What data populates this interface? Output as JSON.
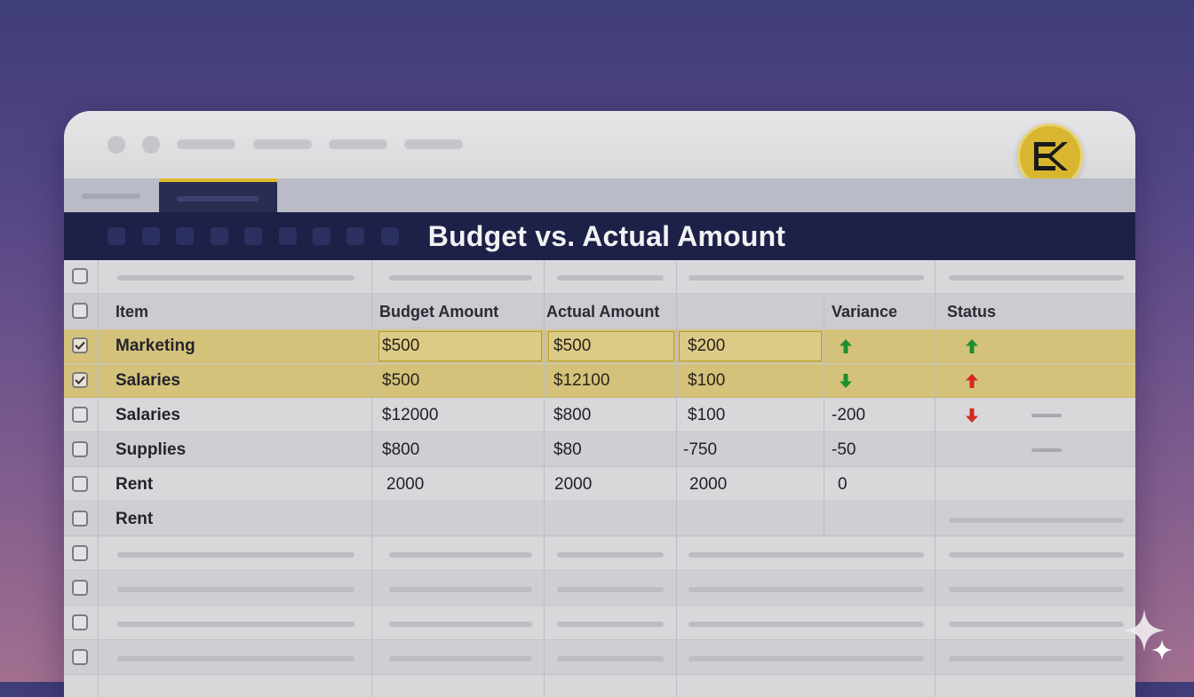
{
  "sheet": {
    "title": "Budget vs. Actual Amount"
  },
  "columns": {
    "item": "Item",
    "budget": "Budget Amount",
    "actual": "Actual Amount",
    "blank": "",
    "variance": "Variance",
    "status": "Status"
  },
  "rows": [
    {
      "checked": true,
      "highlighted": true,
      "item": "Marketing",
      "budget": "$500",
      "actual": "$500",
      "extra": "$200",
      "variance_icon": "arrow-up-green",
      "status_icon": "arrow-up-green",
      "variance": "",
      "status_dash": false
    },
    {
      "checked": true,
      "highlighted": true,
      "item": "Salaries",
      "budget": "$500",
      "actual": "$12100",
      "extra": "$100",
      "variance_icon": "arrow-down-green",
      "status_icon": "arrow-up-red",
      "variance": "",
      "status_dash": false
    },
    {
      "checked": false,
      "highlighted": false,
      "item": "Salaries",
      "budget": "$12000",
      "actual": "$800",
      "extra": "$100",
      "variance_icon": "",
      "status_icon": "arrow-down-red",
      "variance": "-200",
      "status_dash": true
    },
    {
      "checked": false,
      "highlighted": false,
      "item": "Supplies",
      "budget": "$800",
      "actual": "$80",
      "extra": "-750",
      "variance_icon": "",
      "status_icon": "",
      "variance": "-50",
      "status_dash": true
    },
    {
      "checked": false,
      "highlighted": false,
      "item": "Rent",
      "budget": "2000",
      "actual": "2000",
      "extra": "2000",
      "variance_icon": "",
      "status_icon": "",
      "variance": "0",
      "status_dash": false
    },
    {
      "checked": false,
      "highlighted": false,
      "item": "Rent",
      "budget": "",
      "actual": "",
      "extra": "",
      "variance_icon": "",
      "status_icon": "",
      "variance": "",
      "status_dash": false
    }
  ],
  "colors": {
    "accent": "#e0b92a",
    "header": "#1d2147",
    "highlight": "#d4c27b",
    "up_green": "#1f8f2e",
    "red": "#d42a22"
  },
  "icons": {
    "logo": "ek-logo-icon",
    "sparkle": "sparkle-icon"
  }
}
